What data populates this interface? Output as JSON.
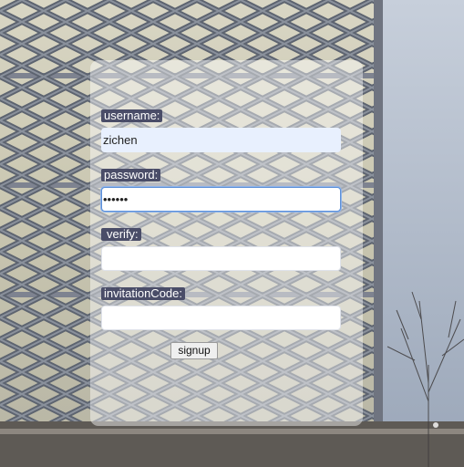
{
  "form": {
    "username": {
      "label": "username:",
      "value": "zichen"
    },
    "password": {
      "label": "password:",
      "value": "••••••"
    },
    "verify": {
      "label": "verify:",
      "value": ""
    },
    "invitation_code": {
      "label": "invitationCode:",
      "value": ""
    },
    "signup_label": "signup"
  },
  "colors": {
    "label_background": "#4a4d68",
    "label_text": "#ffffff",
    "autofill_background": "#e8f0fe",
    "focus_border": "#5b8fd8"
  },
  "background": {
    "subject": "building-facade-with-diamond-lattice-and-bare-tree"
  }
}
